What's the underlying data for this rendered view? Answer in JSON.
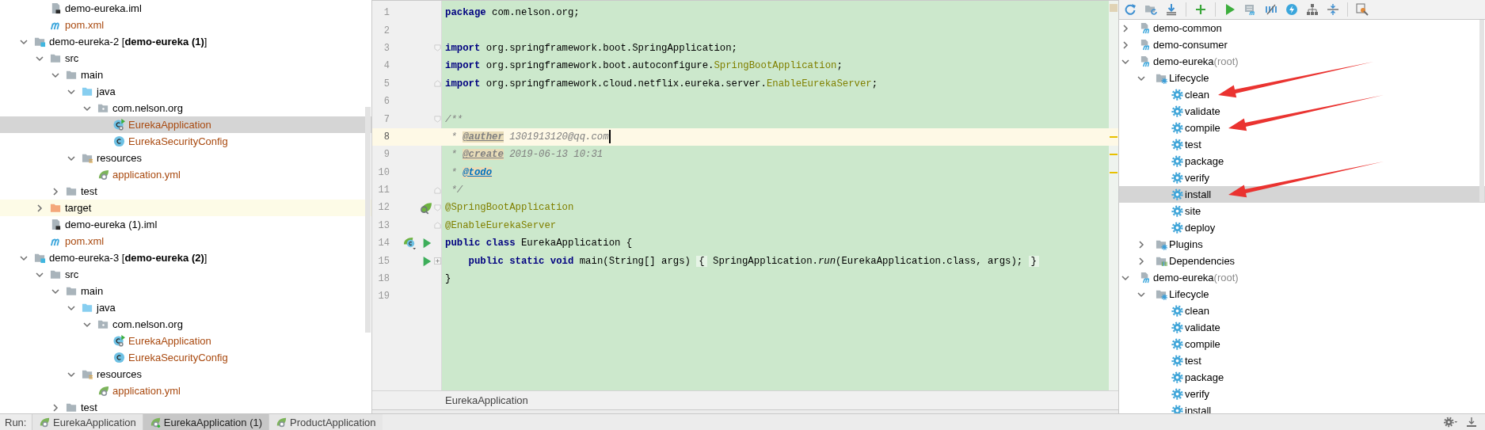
{
  "project_tree": {
    "partial_items": [
      {
        "kind": "iml",
        "label": "demo-eureka.iml",
        "unversioned": false,
        "selected": false,
        "highlighted": false
      },
      {
        "kind": "maven",
        "label": "pom.xml",
        "unversioned": true,
        "selected": false,
        "highlighted": false
      }
    ],
    "modules": [
      {
        "kind": "module",
        "label": "demo-eureka-2 [**demo-eureka (1)**]",
        "expanded": true,
        "unversioned": false,
        "selected": false,
        "highlighted": false,
        "children": [
          {
            "kind": "folder",
            "label": "src",
            "expanded": true,
            "unversioned": false,
            "selected": false,
            "highlighted": false,
            "children": [
              {
                "kind": "folder",
                "label": "main",
                "expanded": true,
                "unversioned": false,
                "selected": false,
                "highlighted": false,
                "children": [
                  {
                    "kind": "sources",
                    "label": "java",
                    "expanded": true,
                    "unversioned": false,
                    "selected": false,
                    "highlighted": false,
                    "children": [
                      {
                        "kind": "package",
                        "label": "com.nelson.org",
                        "expanded": true,
                        "unversioned": false,
                        "selected": false,
                        "highlighted": false,
                        "children": [
                          {
                            "kind": "springclass",
                            "label": "EurekaApplication",
                            "unversioned": true,
                            "selected": true,
                            "highlighted": false
                          },
                          {
                            "kind": "class",
                            "label": "EurekaSecurityConfig",
                            "unversioned": true,
                            "selected": false,
                            "highlighted": false
                          }
                        ]
                      }
                    ]
                  },
                  {
                    "kind": "resources",
                    "label": "resources",
                    "expanded": true,
                    "unversioned": false,
                    "selected": false,
                    "highlighted": false,
                    "children": [
                      {
                        "kind": "config",
                        "label": "application.yml",
                        "unversioned": true,
                        "selected": false,
                        "highlighted": false
                      }
                    ]
                  }
                ]
              },
              {
                "kind": "folder",
                "label": "test",
                "expanded": false,
                "unversioned": false,
                "selected": false,
                "highlighted": false
              }
            ]
          },
          {
            "kind": "excluded",
            "label": "target",
            "expanded": false,
            "unversioned": false,
            "selected": false,
            "highlighted": true
          },
          {
            "kind": "iml",
            "label": "demo-eureka (1).iml",
            "unversioned": false,
            "selected": false,
            "highlighted": false
          },
          {
            "kind": "maven",
            "label": "pom.xml",
            "unversioned": true,
            "selected": false,
            "highlighted": false
          }
        ]
      },
      {
        "kind": "module",
        "label": "demo-eureka-3 [**demo-eureka (2)**]",
        "expanded": true,
        "unversioned": false,
        "selected": false,
        "highlighted": false,
        "children": [
          {
            "kind": "folder",
            "label": "src",
            "expanded": true,
            "unversioned": false,
            "selected": false,
            "highlighted": false,
            "children": [
              {
                "kind": "folder",
                "label": "main",
                "expanded": true,
                "unversioned": false,
                "selected": false,
                "highlighted": false,
                "children": [
                  {
                    "kind": "sources",
                    "label": "java",
                    "expanded": true,
                    "unversioned": false,
                    "selected": false,
                    "highlighted": false,
                    "children": [
                      {
                        "kind": "package",
                        "label": "com.nelson.org",
                        "expanded": true,
                        "unversioned": false,
                        "selected": false,
                        "highlighted": false,
                        "children": [
                          {
                            "kind": "springclass",
                            "label": "EurekaApplication",
                            "unversioned": true,
                            "selected": false,
                            "highlighted": false
                          },
                          {
                            "kind": "class",
                            "label": "EurekaSecurityConfig",
                            "unversioned": true,
                            "selected": false,
                            "highlighted": false
                          }
                        ]
                      }
                    ]
                  },
                  {
                    "kind": "resources",
                    "label": "resources",
                    "expanded": true,
                    "unversioned": false,
                    "selected": false,
                    "highlighted": false,
                    "children": [
                      {
                        "kind": "config",
                        "label": "application.yml",
                        "unversioned": true,
                        "selected": false,
                        "highlighted": false
                      }
                    ]
                  }
                ]
              },
              {
                "kind": "folder",
                "label": "test",
                "expanded": false,
                "unversioned": false,
                "selected": false,
                "highlighted": false
              }
            ]
          }
        ]
      }
    ]
  },
  "editor": {
    "lines": [
      {
        "number": "1",
        "current": false,
        "segments": [
          {
            "kind": "keyword",
            "text": "package"
          },
          {
            "kind": "plain",
            "text": " com.nelson.org;"
          }
        ]
      },
      {
        "number": "2",
        "current": false
      },
      {
        "number": "3",
        "current": false,
        "fold": {
          "kind": "start"
        },
        "segments": [
          {
            "kind": "keyword",
            "text": "import"
          },
          {
            "kind": "plain",
            "text": " org.springframework.boot.SpringApplication;"
          }
        ]
      },
      {
        "number": "4",
        "current": false,
        "segments": [
          {
            "kind": "keyword",
            "text": "import"
          },
          {
            "kind": "plain",
            "text": " org.springframework.boot.autoconfigure."
          },
          {
            "kind": "annotation",
            "text": "SpringBootApplication"
          },
          {
            "kind": "plain",
            "text": ";"
          }
        ]
      },
      {
        "number": "5",
        "current": false,
        "fold": {
          "kind": "end"
        },
        "segments": [
          {
            "kind": "keyword",
            "text": "import"
          },
          {
            "kind": "plain",
            "text": " org.springframework.cloud.netflix.eureka.server."
          },
          {
            "kind": "annotation",
            "text": "EnableEurekaServer"
          },
          {
            "kind": "plain",
            "text": ";"
          }
        ]
      },
      {
        "number": "6",
        "current": false
      },
      {
        "number": "7",
        "current": false,
        "fold": {
          "kind": "start"
        },
        "segments": [
          {
            "kind": "comment",
            "text": "/**"
          }
        ]
      },
      {
        "number": "8",
        "current": true,
        "segments": [
          {
            "kind": "comment",
            "text": " * "
          },
          {
            "kind": "doctag",
            "text": "@auther"
          },
          {
            "kind": "comment",
            "text": " 1301913120@qq.com"
          }
        ]
      },
      {
        "number": "9",
        "current": false,
        "segments": [
          {
            "kind": "comment",
            "text": " * "
          },
          {
            "kind": "doctag",
            "text": "@create"
          },
          {
            "kind": "comment",
            "text": " 2019-06-13 10:31"
          }
        ]
      },
      {
        "number": "10",
        "current": false,
        "segments": [
          {
            "kind": "comment",
            "text": " * "
          },
          {
            "kind": "todotag",
            "text": "@todo"
          }
        ]
      },
      {
        "number": "11",
        "current": false,
        "fold": {
          "kind": "end"
        },
        "segments": [
          {
            "kind": "comment",
            "text": " */"
          }
        ]
      },
      {
        "number": "12",
        "current": false,
        "fold": {
          "kind": "start"
        },
        "markers": [
          {
            "kind": "bean"
          }
        ],
        "segments": [
          {
            "kind": "annotation",
            "text": "@SpringBootApplication"
          }
        ]
      },
      {
        "number": "13",
        "current": false,
        "fold": {
          "kind": "end"
        },
        "segments": [
          {
            "kind": "annotation",
            "text": "@EnableEurekaServer"
          }
        ]
      },
      {
        "number": "14",
        "current": false,
        "markers": [
          {
            "kind": "springclass"
          },
          {
            "kind": "run"
          }
        ],
        "segments": [
          {
            "kind": "keyword",
            "text": "public class"
          },
          {
            "kind": "plain",
            "text": " EurekaApplication {"
          }
        ]
      },
      {
        "number": "15",
        "current": false,
        "fold": {
          "kind": "collapsed"
        },
        "markers": [
          {
            "kind": "run"
          }
        ],
        "segments": [
          {
            "kind": "keyword",
            "text": "    public static void"
          },
          {
            "kind": "plain",
            "text": " main(String[] args) "
          },
          {
            "kind": "folded",
            "text": "{"
          },
          {
            "kind": "plain",
            "text": " SpringApplication."
          },
          {
            "kind": "method",
            "text": "run"
          },
          {
            "kind": "plain",
            "text": "(EurekaApplication.class, args); "
          },
          {
            "kind": "folded",
            "text": "}"
          }
        ]
      },
      {
        "number": "18",
        "current": false,
        "segments": [
          {
            "kind": "plain",
            "text": "}"
          }
        ]
      },
      {
        "number": "19",
        "current": false
      }
    ],
    "breadcrumb": "EurekaApplication"
  },
  "maven_panel": {
    "projects": [
      {
        "kind": "project",
        "label": "demo-common",
        "expanded": false,
        "selected": false
      },
      {
        "kind": "project",
        "label": "demo-consumer",
        "expanded": false,
        "selected": false
      },
      {
        "kind": "project",
        "label": "demo-eureka",
        "suffix": "(root)",
        "expanded": true,
        "selected": false,
        "children": [
          {
            "kind": "lifecycle",
            "label": "Lifecycle",
            "expanded": true,
            "selected": false,
            "children": [
              {
                "kind": "goal",
                "label": "clean",
                "selected": false,
                "arrow_marked": true
              },
              {
                "kind": "goal",
                "label": "validate",
                "selected": false,
                "arrow_marked": false
              },
              {
                "kind": "goal",
                "label": "compile",
                "selected": false,
                "arrow_marked": true
              },
              {
                "kind": "goal",
                "label": "test",
                "selected": false,
                "arrow_marked": false
              },
              {
                "kind": "goal",
                "label": "package",
                "selected": false,
                "arrow_marked": false
              },
              {
                "kind": "goal",
                "label": "verify",
                "selected": false,
                "arrow_marked": false
              },
              {
                "kind": "goal",
                "label": "install",
                "selected": true,
                "arrow_marked": true
              },
              {
                "kind": "goal",
                "label": "site",
                "selected": false,
                "arrow_marked": false
              },
              {
                "kind": "goal",
                "label": "deploy",
                "selected": false,
                "arrow_marked": false
              }
            ]
          },
          {
            "kind": "plugins",
            "label": "Plugins",
            "expanded": false,
            "selected": false
          },
          {
            "kind": "dependencies",
            "label": "Dependencies",
            "expanded": false,
            "selected": false
          }
        ]
      },
      {
        "kind": "project",
        "label": "demo-eureka",
        "suffix": "(root)",
        "expanded": true,
        "selected": false,
        "children": [
          {
            "kind": "lifecycle",
            "label": "Lifecycle",
            "expanded": true,
            "selected": false,
            "children": [
              {
                "kind": "goal",
                "label": "clean",
                "selected": false,
                "arrow_marked": false
              },
              {
                "kind": "goal",
                "label": "validate",
                "selected": false,
                "arrow_marked": false
              },
              {
                "kind": "goal",
                "label": "compile",
                "selected": false,
                "arrow_marked": false
              },
              {
                "kind": "goal",
                "label": "test",
                "selected": false,
                "arrow_marked": false
              },
              {
                "kind": "goal",
                "label": "package",
                "selected": false,
                "arrow_marked": false
              },
              {
                "kind": "goal",
                "label": "verify",
                "selected": false,
                "arrow_marked": false
              },
              {
                "kind": "goal",
                "label": "install",
                "selected": false,
                "arrow_marked": false
              }
            ]
          }
        ]
      }
    ]
  },
  "run_bar": {
    "label": "Run:",
    "tabs": [
      {
        "label": "EurekaApplication",
        "selected": false,
        "running": false
      },
      {
        "label": "EurekaApplication (1)",
        "selected": true,
        "running": true
      },
      {
        "label": "ProductApplication",
        "selected": false,
        "running": false
      }
    ]
  }
}
